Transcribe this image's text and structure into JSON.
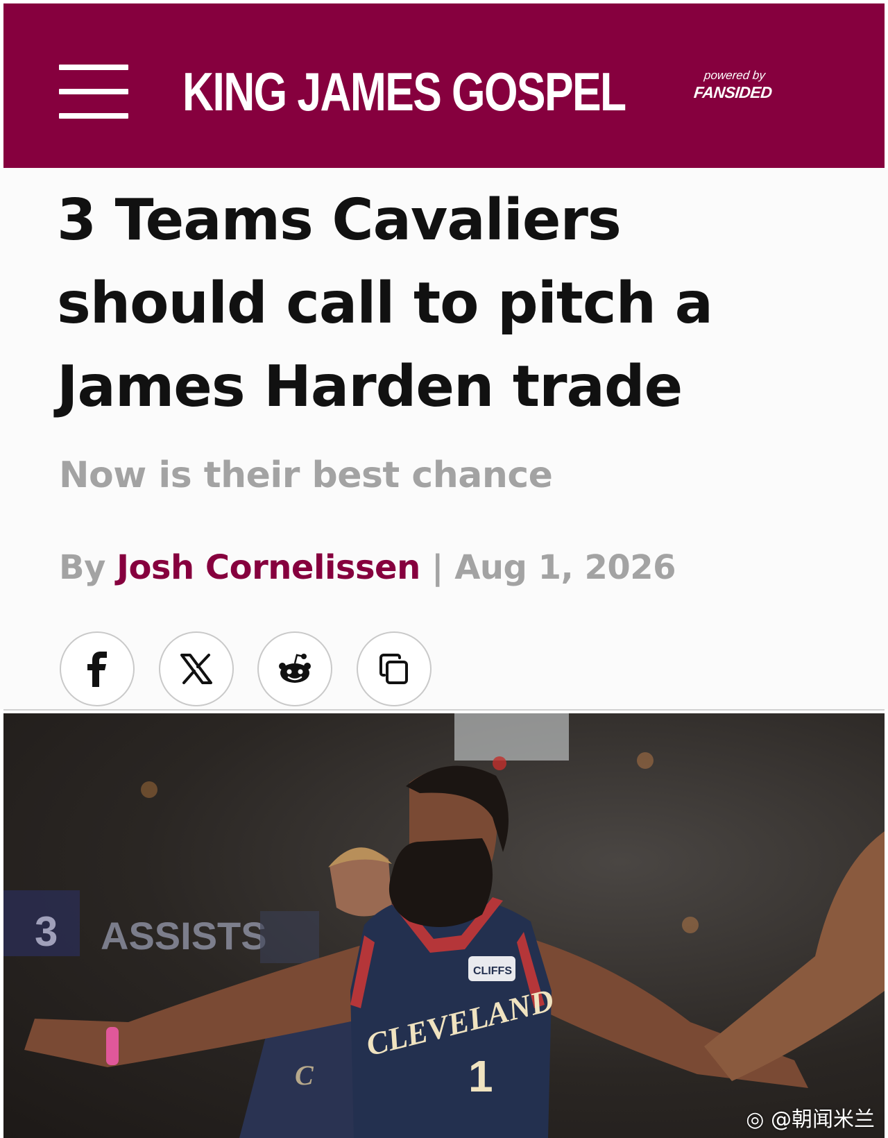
{
  "colors": {
    "brand": "#86003e",
    "muted_text": "#a3a3a3",
    "headline": "#111111"
  },
  "header": {
    "menu_icon": "hamburger-menu-icon",
    "logo_text": "KING JAMES GOSPEL",
    "powered_by": "powered by",
    "powered_brand": "FANSIDED"
  },
  "article": {
    "headline": "3 Teams Cavaliers should call to pitch a James Harden trade",
    "subheadline": "Now is their best chance",
    "byline_prefix": "By",
    "author": "Josh Cornelissen",
    "separator": "|",
    "date": "Aug 1, 2026"
  },
  "share": [
    {
      "icon": "facebook-icon"
    },
    {
      "icon": "x-twitter-icon"
    },
    {
      "icon": "reddit-icon"
    },
    {
      "icon": "copy-link-icon"
    }
  ],
  "hero_image": {
    "jersey_text": "CLEVELAND",
    "jersey_number": "1",
    "jersey_sponsor": "CLIFFS",
    "scoreboard_text": "ASSISTS"
  },
  "watermark": "@朝闻米兰"
}
